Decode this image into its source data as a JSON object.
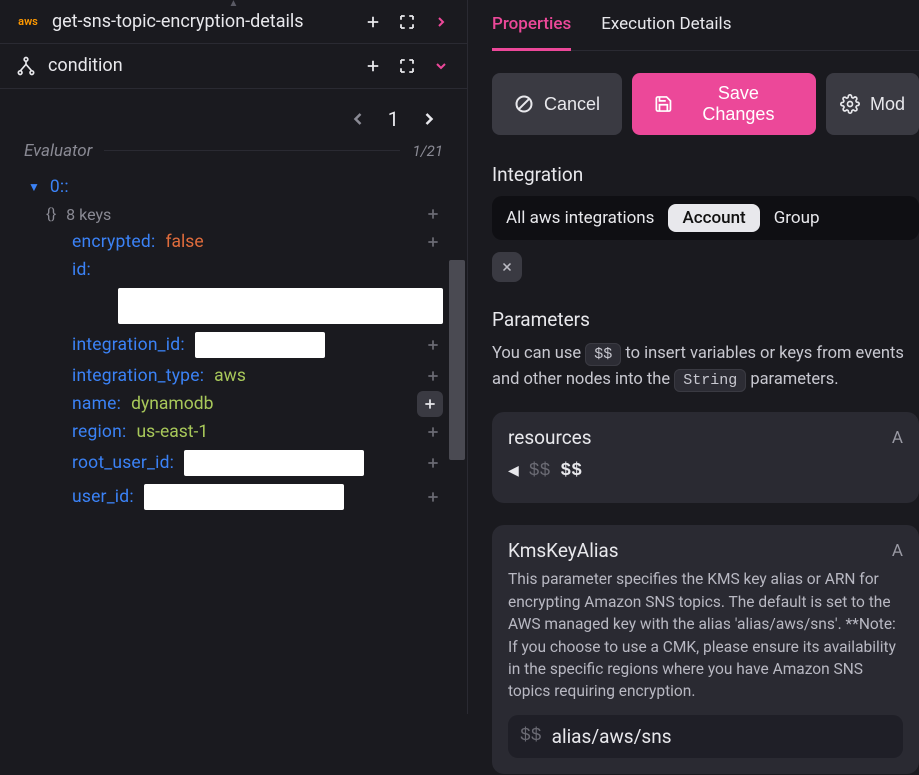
{
  "left": {
    "nodes": [
      {
        "title": "get-sns-topic-encryption-details",
        "icon": "aws"
      },
      {
        "title": "condition",
        "icon": "branch"
      }
    ],
    "pager": {
      "current": "1",
      "count": "1/21"
    },
    "evaluator_label": "Evaluator",
    "tree": {
      "root_index": "0:",
      "keys_summary": "8 keys",
      "rows": [
        {
          "k": "encrypted",
          "v": "false",
          "vclass": "val-false"
        },
        {
          "k": "id",
          "v": ""
        },
        {
          "k": "integration_id",
          "v": ""
        },
        {
          "k": "integration_type",
          "v": "aws",
          "vclass": "val-str"
        },
        {
          "k": "name",
          "v": "dynamodb",
          "vclass": "val-str"
        },
        {
          "k": "region",
          "v": "us-east-1",
          "vclass": "val-str"
        },
        {
          "k": "root_user_id",
          "v": ""
        },
        {
          "k": "user_id",
          "v": ""
        }
      ]
    }
  },
  "right": {
    "tabs": {
      "properties": "Properties",
      "exec": "Execution Details"
    },
    "buttons": {
      "cancel": "Cancel",
      "save": "Save Changes",
      "more": "Mod"
    },
    "integration": {
      "label": "Integration",
      "all": "All aws integrations",
      "account": "Account",
      "group": "Group"
    },
    "parameters": {
      "label": "Parameters",
      "desc_pre": "You can use ",
      "desc_code1": "$$",
      "desc_mid": " to insert variables or keys from events and other nodes into the ",
      "desc_code2": "String",
      "desc_post": " parameters.",
      "resources": {
        "name": "resources",
        "a": "A",
        "dd": "$$",
        "dd_ghost": "$$"
      },
      "kms": {
        "name": "KmsKeyAlias",
        "a": "A",
        "help": "This parameter specifies the KMS key alias or ARN for encrypting Amazon SNS topics. The default is set to the AWS managed key with the alias 'alias/aws/sns'. **Note: If you choose to use a CMK, please ensure its availability in the specific regions where you have Amazon SNS topics requiring encryption.",
        "dd": "$$",
        "value": "alias/aws/sns"
      }
    }
  }
}
